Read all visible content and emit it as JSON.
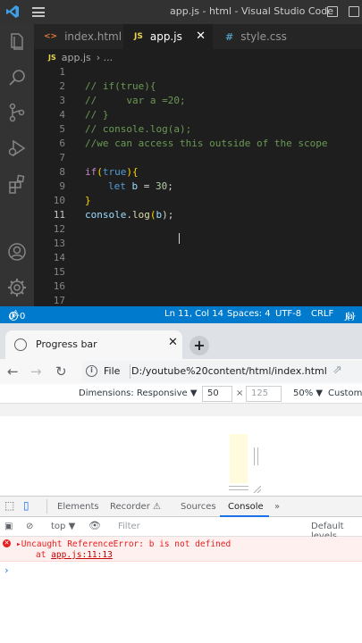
{
  "vscode": {
    "title": "app.js - html - Visual Studio Code",
    "tabs": [
      {
        "icon": "<>",
        "label": "index.html",
        "active": false
      },
      {
        "icon": "JS",
        "label": "app.js",
        "active": true
      },
      {
        "icon": "#",
        "label": "style.css",
        "active": false
      }
    ],
    "breadcrumb": {
      "icon": "JS",
      "file": "app.js",
      "sep": "› ..."
    },
    "lines": [
      {
        "n": "1"
      },
      {
        "n": "2"
      },
      {
        "n": "3"
      },
      {
        "n": "4"
      },
      {
        "n": "5"
      },
      {
        "n": "6"
      },
      {
        "n": "7"
      },
      {
        "n": "8"
      },
      {
        "n": "9"
      },
      {
        "n": "10"
      },
      {
        "n": "11"
      },
      {
        "n": "12"
      },
      {
        "n": "13"
      },
      {
        "n": "14"
      },
      {
        "n": "15"
      },
      {
        "n": "16"
      },
      {
        "n": "17"
      }
    ],
    "code": {
      "l2": "// if(true){",
      "l3": "//     var a =20;",
      "l4": "// }",
      "l5": "// console.log(a);",
      "l6": "//we can access this outside of the scope",
      "l8_if": "if",
      "l8_paren_open": "(",
      "l8_true": "true",
      "l8_paren_close": ")",
      "l8_brace": "{",
      "l9_let": "let",
      "l9_var": "b",
      "l9_eq": " = ",
      "l9_num": "30",
      "l9_semi": ";",
      "l10_brace": "}",
      "l11_console": "console",
      "l11_dot": ".",
      "l11_log": "log",
      "l11_open": "(",
      "l11_b": "b",
      "l11_close": ");"
    },
    "status": {
      "errors": "0",
      "warnings": "0",
      "position": "Ln 11, Col 14",
      "spaces": "Spaces: 4",
      "encoding": "UTF-8",
      "eol": "CRLF",
      "lang": "Ja"
    }
  },
  "chrome": {
    "tab_title": "Progress bar",
    "tab_close": "✕",
    "newtab": "+",
    "omnibox": {
      "scheme": "File",
      "url": "D:/youtube%20content/html/index.html"
    },
    "devbar": {
      "dimensions": "Dimensions: Responsive ▼",
      "width": "50",
      "height": "125",
      "times": "×",
      "zoom": "50% ▼",
      "custom": "Custom"
    },
    "devtools_tabs": [
      "Elements",
      "Recorder ⚠",
      "Sources",
      "Console",
      "»"
    ],
    "console_toolbar": {
      "context": "top ▼",
      "filter": "Filter",
      "levels": "Default levels"
    },
    "error": {
      "message": "▸Uncaught ReferenceError: b is not defined",
      "at": "at ",
      "link": "app.js:11:13"
    },
    "prompt": "›"
  }
}
